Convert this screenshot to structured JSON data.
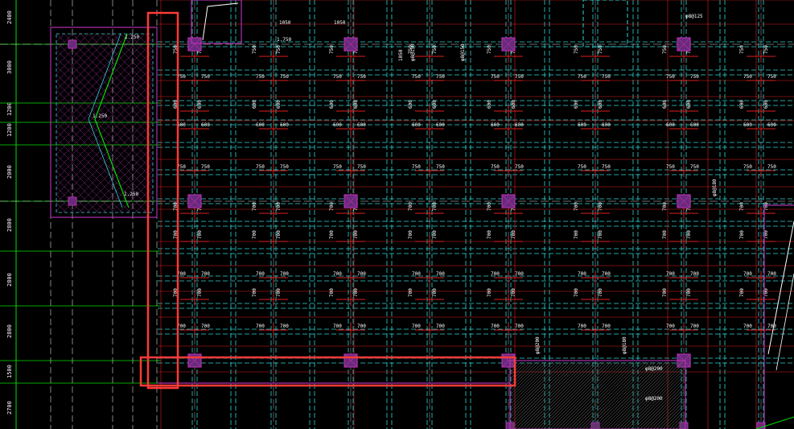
{
  "colors": {
    "background": "#000000",
    "grid_green": "#00e000",
    "axis_white": "#d9d9d9",
    "beam_cyan": "#2fd6d6",
    "rebar_red": "#e01e1e",
    "column_magenta": "#b030b0",
    "highlight_red": "#ff3a3a",
    "text_white": "#ffffff"
  },
  "left_dimensions": [
    "2400",
    "3000",
    "1200",
    "1200",
    "2000",
    "2800",
    "2800",
    "2800",
    "1500",
    "2700"
  ],
  "column_labels": [
    "750",
    "750",
    "750",
    "750",
    "750",
    "750",
    "750",
    "750",
    "750",
    "750",
    "750",
    "750"
  ],
  "span_labels_600": [
    "600",
    "600",
    "600",
    "600",
    "600",
    "600",
    "600",
    "600",
    "600",
    "600",
    "600",
    "600"
  ],
  "span_labels_700": [
    "700",
    "700",
    "700",
    "700",
    "700",
    "700",
    "700",
    "700",
    "700",
    "700",
    "700",
    "700"
  ],
  "beam_callouts": [
    "1050",
    "1050",
    "1050",
    "φ8@150",
    "φ8@150",
    "φ8@125",
    "φ8@200",
    "φ8@180",
    "φ8@180",
    "φ8@200",
    "1.750",
    "1.250",
    "1.250",
    "1.250"
  ],
  "highlights": {
    "vertical_box": "selection-vertical",
    "horizontal_box": "selection-horizontal"
  }
}
